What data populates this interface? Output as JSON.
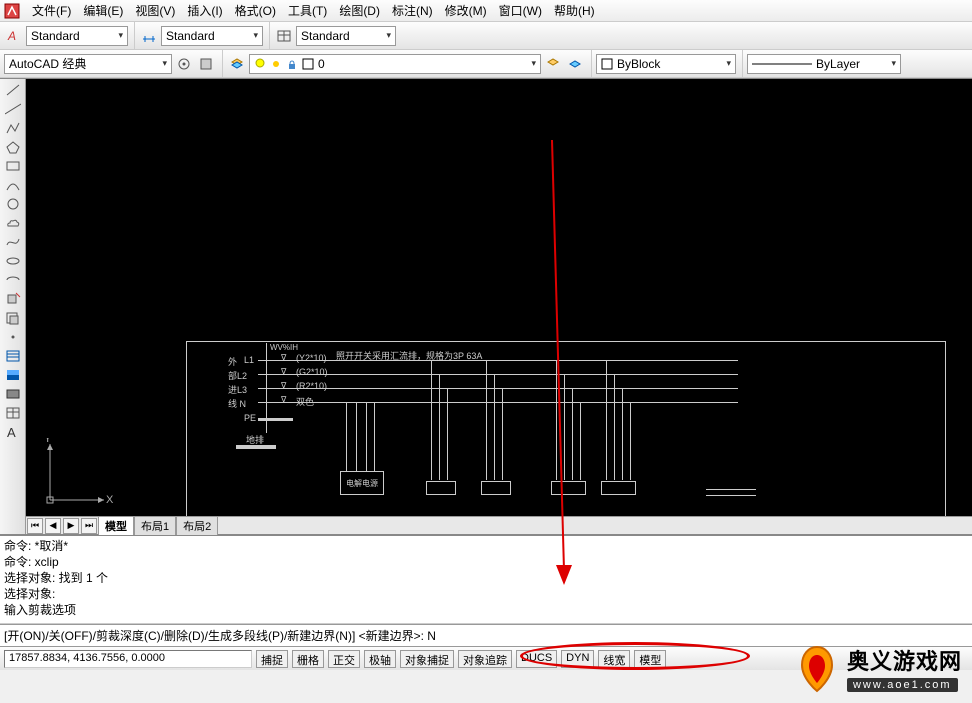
{
  "menu": {
    "items": [
      "文件(F)",
      "编辑(E)",
      "视图(V)",
      "插入(I)",
      "格式(O)",
      "工具(T)",
      "绘图(D)",
      "标注(N)",
      "修改(M)",
      "窗口(W)",
      "帮助(H)"
    ]
  },
  "styles": {
    "text_style": "Standard",
    "dim_style": "Standard",
    "table_style": "Standard",
    "workspace": "AutoCAD 经典",
    "layer_current": "0",
    "color_current": "ByBlock",
    "linetype_current": "ByLayer"
  },
  "tabs": {
    "items": [
      "模型",
      "布局1",
      "布局2"
    ],
    "active": 0
  },
  "ucs": {
    "x": "X",
    "y": "Y"
  },
  "diagram": {
    "title": "照开开关采用汇流排，规格为3P 63A",
    "rows": [
      {
        "left": "外",
        "l2": "L1",
        "wire": "(Y2*10)"
      },
      {
        "left": "部L2",
        "l2": "",
        "wire": "(G2*10)"
      },
      {
        "left": "进L3",
        "l2": "",
        "wire": "(R2*10)"
      },
      {
        "left": "线 N",
        "l2": "",
        "wire": "双色"
      }
    ],
    "pe": "PE",
    "gnd": "地排",
    "box_label": "电解电源"
  },
  "cmd": {
    "hist": [
      "命令: *取消*",
      "命令: xclip",
      "选择对象: 找到 1 个",
      "选择对象:",
      "输入剪裁选项"
    ],
    "prompt": "[开(ON)/关(OFF)/剪裁深度(C)/删除(D)/生成多段线(P)/新建边界(N)] <新建边界>: N"
  },
  "status": {
    "coords": "17857.8834, 4136.7556, 0.0000",
    "buttons": [
      "捕捉",
      "栅格",
      "正交",
      "极轴",
      "对象捕捉",
      "对象追踪",
      "DUCS",
      "DYN",
      "线宽",
      "模型"
    ]
  },
  "watermark": {
    "title": "奥义游戏网",
    "url": "www.aoe1.com"
  }
}
